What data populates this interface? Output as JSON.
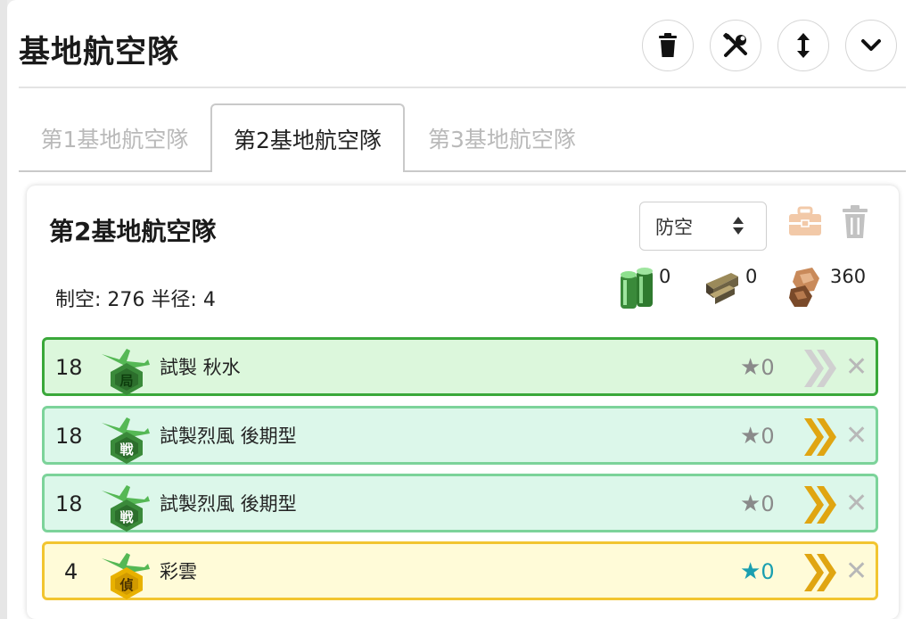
{
  "header": {
    "title": "基地航空隊",
    "buttons": [
      {
        "name": "delete-button",
        "icon": "trash-icon"
      },
      {
        "name": "tools-button",
        "icon": "wrench-screwdriver-icon"
      },
      {
        "name": "sort-button",
        "icon": "up-down-arrow-icon"
      },
      {
        "name": "collapse-button",
        "icon": "chevron-down-icon"
      }
    ]
  },
  "tabs": [
    {
      "label": "第1基地航空隊",
      "active": false
    },
    {
      "label": "第2基地航空隊",
      "active": true
    },
    {
      "label": "第3基地航空隊",
      "active": false
    }
  ],
  "card": {
    "title": "第2基地航空隊",
    "mode_select": {
      "value": "防空"
    },
    "stats": {
      "air_label": "制空:",
      "air_value": "276",
      "radius_label": "半径:",
      "radius_value": "4"
    },
    "resources": [
      {
        "icon": "fuel-icon",
        "value": "0"
      },
      {
        "icon": "ammo-icon",
        "value": "0"
      },
      {
        "icon": "bauxite-icon",
        "value": "360"
      }
    ],
    "slots": [
      {
        "count": "18",
        "badge": "局",
        "name": "試製 秋水",
        "stars": "0",
        "star_color": "#8a8a8a",
        "proficiency": "gray",
        "bg": "#dcf7dc",
        "border": "#3aa83a"
      },
      {
        "count": "18",
        "badge": "戦",
        "name": "試製烈風 後期型",
        "stars": "0",
        "star_color": "#8a8a8a",
        "proficiency": "gold",
        "bg": "#dcf7ea",
        "border": "#7cd39a"
      },
      {
        "count": "18",
        "badge": "戦",
        "name": "試製烈風 後期型",
        "stars": "0",
        "star_color": "#8a8a8a",
        "proficiency": "gold",
        "bg": "#dcf7ea",
        "border": "#7cd39a"
      },
      {
        "count": "4",
        "badge": "偵",
        "name": "彩雲",
        "stars": "0",
        "star_color": "#1a9fb0",
        "proficiency": "gold",
        "bg": "#fffbd8",
        "border": "#f2c530"
      }
    ]
  },
  "colors": {
    "accent_gold": "#e0a511",
    "hexagon_green": "#2f7d2f",
    "hexagon_yellow": "#e8b100"
  }
}
